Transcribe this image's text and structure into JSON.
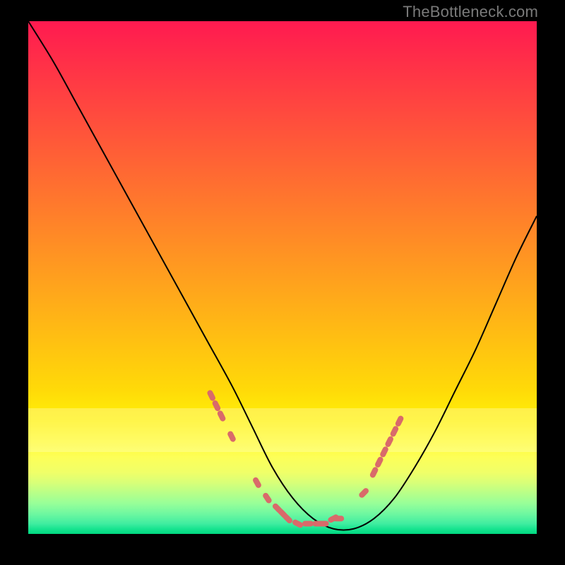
{
  "watermark": "TheBottleneck.com",
  "chart_data": {
    "type": "line",
    "title": "",
    "xlabel": "",
    "ylabel": "",
    "xlim": [
      0,
      100
    ],
    "ylim": [
      0,
      100
    ],
    "grid": false,
    "legend": false,
    "series": [
      {
        "name": "bottleneck-curve",
        "x": [
          0,
          5,
          10,
          15,
          20,
          25,
          30,
          35,
          40,
          44,
          48,
          52,
          56,
          60,
          64,
          68,
          72,
          76,
          80,
          84,
          88,
          92,
          96,
          100
        ],
        "y": [
          100,
          92,
          83,
          74,
          65,
          56,
          47,
          38,
          29,
          21,
          13,
          7,
          3,
          1,
          1,
          3,
          7,
          13,
          20,
          28,
          36,
          45,
          54,
          62
        ]
      }
    ],
    "markers": {
      "name": "highlight-points",
      "color": "#d96a6a",
      "x": [
        36,
        37,
        38,
        40,
        45,
        47,
        49,
        50,
        51,
        53,
        55,
        57,
        58,
        60,
        61,
        66,
        68,
        69,
        70,
        71,
        72,
        73
      ],
      "y": [
        27,
        25,
        23,
        19,
        10,
        7,
        5,
        4,
        3,
        2,
        2,
        2,
        2,
        3,
        3,
        8,
        12,
        14,
        16,
        18,
        20,
        22
      ]
    },
    "background_gradient": {
      "top": "#ff1a50",
      "mid": "#ffda08",
      "bottom": "#00d880"
    }
  }
}
